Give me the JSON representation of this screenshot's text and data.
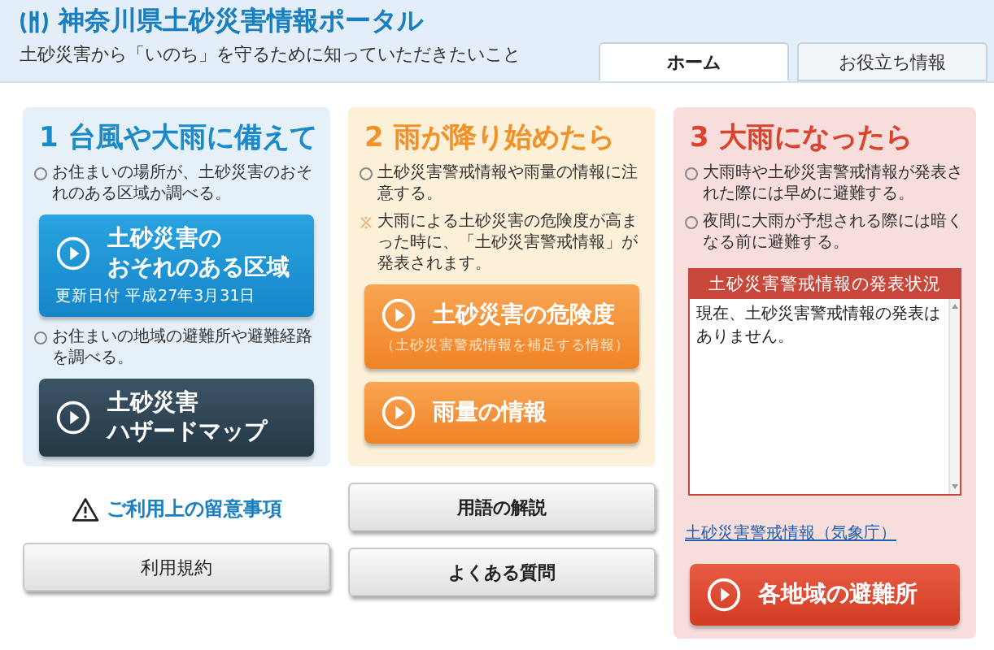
{
  "header": {
    "title": "神奈川県土砂災害情報ポータル",
    "subtitle": "土砂災害から「いのち」を守るために知っていただきたいこと"
  },
  "tabs": [
    {
      "label": "ホーム",
      "selected": true
    },
    {
      "label": "お役立ち情報",
      "selected": false
    }
  ],
  "columns": [
    {
      "number": "1",
      "title": "台風や大雨に備えて",
      "items": [
        {
          "kind": "bullet",
          "text": "お住まいの場所が、土砂災害のおそれのある区域か調べる。"
        },
        {
          "kind": "button",
          "lines": [
            "土砂災害の",
            "おそれのある区域"
          ],
          "sub": "更新日付 平成27年3月31日"
        },
        {
          "kind": "bullet",
          "text": "お住まいの地域の避難所や避難経路を調べる。"
        },
        {
          "kind": "button",
          "lines": [
            "土砂災害",
            "ハザードマップ"
          ]
        }
      ],
      "footer": [
        {
          "kind": "notice",
          "text": "ご利用上の留意事項"
        },
        {
          "kind": "plain",
          "text": "利用規約"
        }
      ]
    },
    {
      "number": "2",
      "title": "雨が降り始めたら",
      "items": [
        {
          "kind": "bullet",
          "text": "土砂災害警戒情報や雨量の情報に注意する。"
        },
        {
          "kind": "note",
          "text": "大雨による土砂災害の危険度が高まった時に、「土砂災害警戒情報」が発表されます。"
        },
        {
          "kind": "button",
          "lines": [
            "土砂災害の危険度"
          ],
          "sub": "（土砂災害警戒情報を補足する情報）"
        },
        {
          "kind": "button",
          "lines": [
            "雨量の情報"
          ]
        }
      ],
      "footer": [
        {
          "kind": "plain",
          "text": "用語の解説"
        },
        {
          "kind": "plain",
          "text": "よくある質問"
        }
      ]
    },
    {
      "number": "3",
      "title": "大雨になったら",
      "items": [
        {
          "kind": "bullet",
          "text": "大雨時や土砂災害警戒情報が発表された際には早めに避難する。"
        },
        {
          "kind": "bullet",
          "text": "夜間に大雨が予想される際には暗くなる前に避難する。"
        },
        {
          "kind": "status",
          "heading": "土砂災害警戒情報の発表状況",
          "message": "現在、土砂災害警戒情報の発表はありません。"
        },
        {
          "kind": "link",
          "text": "土砂災害警戒情報（気象庁）"
        },
        {
          "kind": "button",
          "lines": [
            "各地域の避難所"
          ]
        }
      ]
    }
  ]
}
